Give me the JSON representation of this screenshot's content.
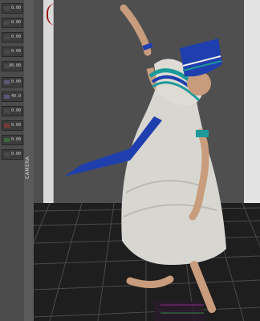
{
  "left_panel": {
    "controls": [
      {
        "value": "0.00",
        "swatch": "#4a4a4a"
      },
      {
        "value": "0.00",
        "swatch": "#4a4a4a"
      },
      {
        "value": "0.00",
        "swatch": "#4a4a4a"
      },
      {
        "value": "0.00",
        "swatch": "#4a4a4a"
      },
      {
        "value": "40.00",
        "swatch": "#4a4a4a"
      },
      {
        "value": "0.00",
        "swatch": "#5a5a78"
      },
      {
        "value": "40.0",
        "swatch": "#5a5a78"
      },
      {
        "value": "0.00",
        "swatch": "#4a4a4a"
      },
      {
        "value": "0.00",
        "swatch": "#7a3a3a"
      },
      {
        "value": "0.00",
        "swatch": "#3a6a3a"
      },
      {
        "value": "0.00",
        "swatch": "#4a4a4a"
      }
    ],
    "rail_label": "CAMERA"
  },
  "viewport": {
    "accent_blue": "#1f3fae",
    "dress_color": "#d8d6d0",
    "floor_color": "#1e1e1e"
  }
}
